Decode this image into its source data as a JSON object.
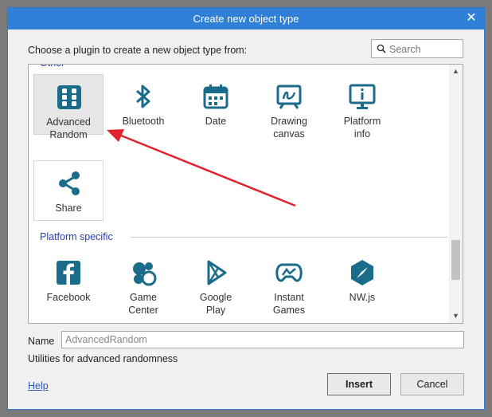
{
  "dialog": {
    "title": "Create new object type",
    "close_glyph": "✕",
    "prompt": "Choose a plugin to create a new object type from:"
  },
  "search": {
    "placeholder": "Search"
  },
  "list": {
    "section_other_partial": "Other",
    "section_platform": "Platform specific",
    "other_items": [
      {
        "label": "Advanced\nRandom",
        "icon": "dice-icon"
      },
      {
        "label": "Bluetooth",
        "icon": "bluetooth-icon"
      },
      {
        "label": "Date",
        "icon": "calendar-icon"
      },
      {
        "label": "Drawing\ncanvas",
        "icon": "drawing-canvas-icon"
      },
      {
        "label": "Platform\ninfo",
        "icon": "platform-info-icon"
      },
      {
        "label": "Share",
        "icon": "share-icon"
      }
    ],
    "platform_items": [
      {
        "label": "Facebook",
        "icon": "facebook-icon"
      },
      {
        "label": "Game\nCenter",
        "icon": "game-center-icon"
      },
      {
        "label": "Google\nPlay",
        "icon": "google-play-icon"
      },
      {
        "label": "Instant\nGames",
        "icon": "instant-games-icon"
      },
      {
        "label": "NW.js",
        "icon": "nwjs-icon"
      }
    ]
  },
  "form": {
    "name_label": "Name",
    "name_value": "AdvancedRandom",
    "description": "Utilities for advanced randomness"
  },
  "footer": {
    "help_label": "Help",
    "insert_label": "Insert",
    "cancel_label": "Cancel"
  },
  "colors": {
    "accent": "#2f80d6",
    "icon": "#1b6b8a",
    "annotation": "#e0242f"
  }
}
